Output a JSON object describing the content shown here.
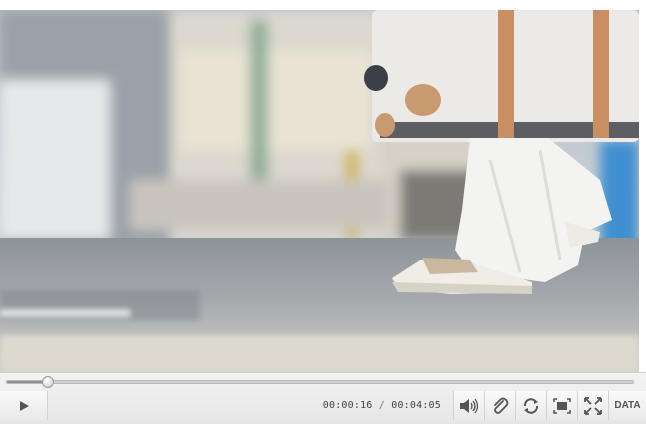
{
  "player": {
    "current_time": "00:00:16",
    "time_separator": "/",
    "total_time": "00:04:05",
    "progress_fraction": 0.065,
    "data_label": "DATA"
  },
  "icons": {
    "play": "play-icon",
    "volume": "volume-icon",
    "link": "paperclip-icon",
    "loop": "loop-icon",
    "fit": "fit-screen-icon",
    "fullscreen": "fullscreen-icon"
  },
  "colors": {
    "control_bg": "#ececec",
    "icon": "#555555",
    "suitcase_strap": "#c98e62"
  }
}
